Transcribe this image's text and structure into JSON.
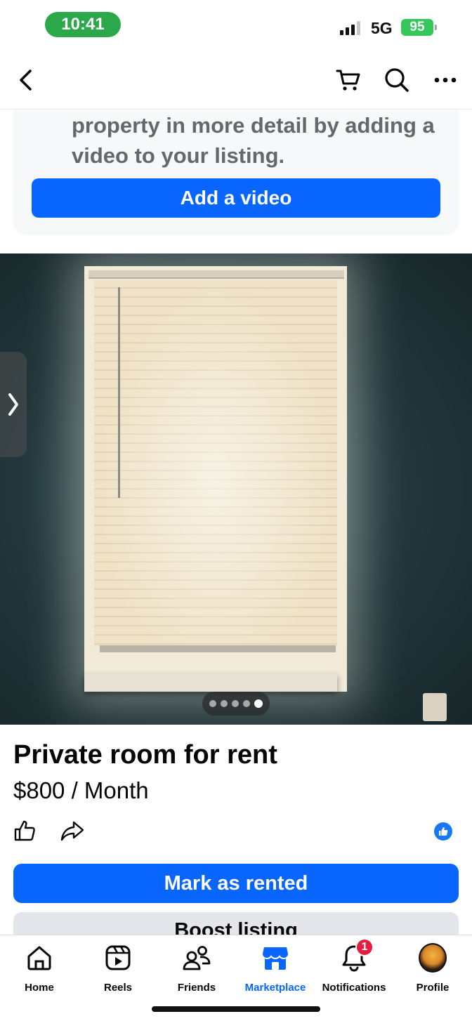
{
  "status_bar": {
    "time": "10:41",
    "network": "5G",
    "battery": "95"
  },
  "nav": {
    "back_icon": "chevron-left-icon",
    "cart_icon": "cart-icon",
    "search_icon": "search-icon",
    "more_icon": "more-icon"
  },
  "video_prompt": {
    "text": "property in more detail by adding a video to your listing.",
    "button_label": "Add a video"
  },
  "photo": {
    "total_photos": 5,
    "active_index": 5
  },
  "listing": {
    "title": "Private room for rent",
    "price": "$800 / Month",
    "mark_rented_label": "Mark as rented",
    "boost_label": "Boost listing"
  },
  "tabs": [
    {
      "label": "Home",
      "icon": "home-icon"
    },
    {
      "label": "Reels",
      "icon": "reels-icon"
    },
    {
      "label": "Friends",
      "icon": "friends-icon"
    },
    {
      "label": "Marketplace",
      "icon": "marketplace-icon",
      "active": true
    },
    {
      "label": "Notifications",
      "icon": "bell-icon",
      "badge": "1"
    },
    {
      "label": "Profile",
      "icon": "avatar"
    }
  ],
  "colors": {
    "accent": "#0866ff",
    "badge": "#e41e3f",
    "time_pill": "#2aa84a"
  }
}
